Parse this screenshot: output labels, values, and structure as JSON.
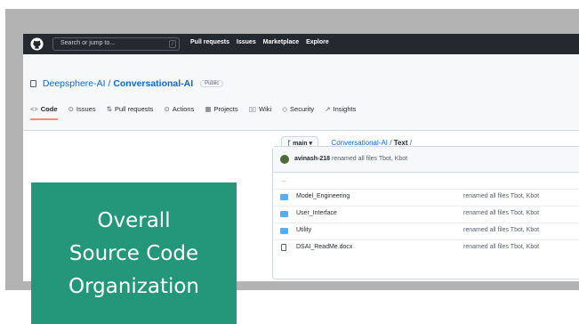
{
  "header": {
    "search_placeholder": "Search or jump to...",
    "slash_key": "/",
    "nav": [
      "Pull requests",
      "Issues",
      "Marketplace",
      "Explore"
    ]
  },
  "repo": {
    "owner": "Deepsphere-AI",
    "separator": " / ",
    "name": "Conversational-AI",
    "visibility": "Public"
  },
  "tabs": [
    {
      "icon": "<>",
      "label": "Code"
    },
    {
      "icon": "⊙",
      "label": "Issues"
    },
    {
      "icon": "⇅",
      "label": "Pull requests"
    },
    {
      "icon": "⊙",
      "label": "Actions"
    },
    {
      "icon": "▦",
      "label": "Projects"
    },
    {
      "icon": "▯▯",
      "label": "Wiki"
    },
    {
      "icon": "◇",
      "label": "Security"
    },
    {
      "icon": "↗",
      "label": "Insights"
    }
  ],
  "branch": {
    "icon": "ᚴ",
    "label": "main",
    "caret": "▾"
  },
  "breadcrumb": {
    "repo": "Conversational-AI",
    "separator": " / ",
    "folder": "Text",
    "trail": " /"
  },
  "commit": {
    "user": "avinash-218",
    "message": "renamed all files Tbot, Kbot"
  },
  "updir": "..",
  "files": [
    {
      "type": "folder",
      "name": "Model_Engineering",
      "message": "renamed all files Tbot, Kbot"
    },
    {
      "type": "folder",
      "name": "User_Interface",
      "message": "renamed all files Tbot, Kbot"
    },
    {
      "type": "folder",
      "name": "Utility",
      "message": "renamed all files Tbot, Kbot"
    },
    {
      "type": "file",
      "name": "DSAI_ReadMe.docx",
      "message": "renamed all files Tbot, Kbot"
    }
  ],
  "callout": {
    "lines": [
      "Overall",
      "Source Code",
      "Organization"
    ]
  },
  "colors": {
    "callout": "#24967a",
    "header": "#24292f",
    "link": "#0969da",
    "folder": "#54aeff"
  }
}
